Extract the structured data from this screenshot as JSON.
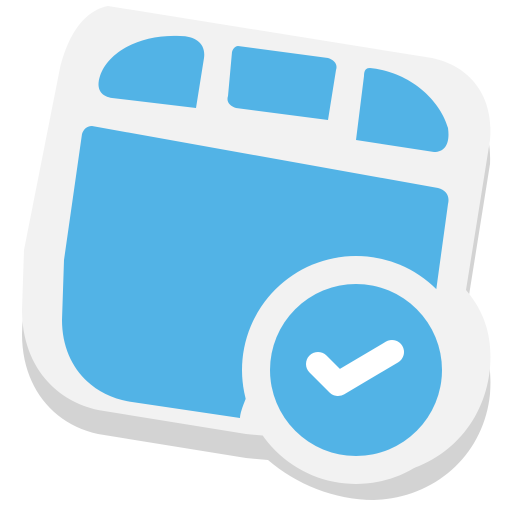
{
  "icon": {
    "name": "video-verified-sticker-icon",
    "colors": {
      "blue": "#52b3e6",
      "sticker": "#f2f2f2",
      "shadow": "#d3d3d3",
      "check": "#ffffff"
    }
  }
}
